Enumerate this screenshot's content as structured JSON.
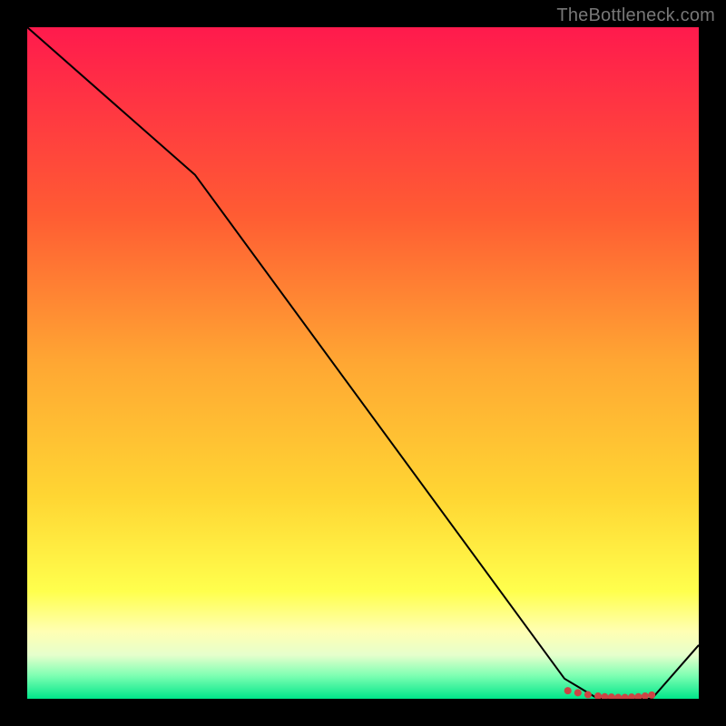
{
  "watermark": "TheBottleneck.com",
  "chart_data": {
    "type": "line",
    "title": "",
    "xlabel": "",
    "ylabel": "",
    "xlim": [
      0,
      100
    ],
    "ylim": [
      0,
      100
    ],
    "series": [
      {
        "name": "curve",
        "x": [
          0,
          25,
          80,
          85,
          93,
          100
        ],
        "y": [
          100,
          78,
          3,
          0,
          0,
          8
        ],
        "stroke": "#000000",
        "width": 2
      }
    ],
    "markers": {
      "name": "dots",
      "x": [
        80.5,
        82,
        83.5,
        85,
        86,
        87,
        88,
        89,
        90,
        91,
        92,
        93
      ],
      "y": [
        1.2,
        0.9,
        0.6,
        0.4,
        0.3,
        0.25,
        0.2,
        0.2,
        0.25,
        0.3,
        0.4,
        0.55
      ],
      "color": "#cc4444",
      "r": 4
    },
    "background_gradient": {
      "stops": [
        {
          "offset": 0.0,
          "color": "#ff1a4d"
        },
        {
          "offset": 0.28,
          "color": "#ff5c33"
        },
        {
          "offset": 0.5,
          "color": "#ffa733"
        },
        {
          "offset": 0.7,
          "color": "#ffd633"
        },
        {
          "offset": 0.84,
          "color": "#ffff4d"
        },
        {
          "offset": 0.9,
          "color": "#ffffb3"
        },
        {
          "offset": 0.935,
          "color": "#e6ffcc"
        },
        {
          "offset": 0.965,
          "color": "#80ffb3"
        },
        {
          "offset": 1.0,
          "color": "#00e68a"
        }
      ]
    }
  }
}
